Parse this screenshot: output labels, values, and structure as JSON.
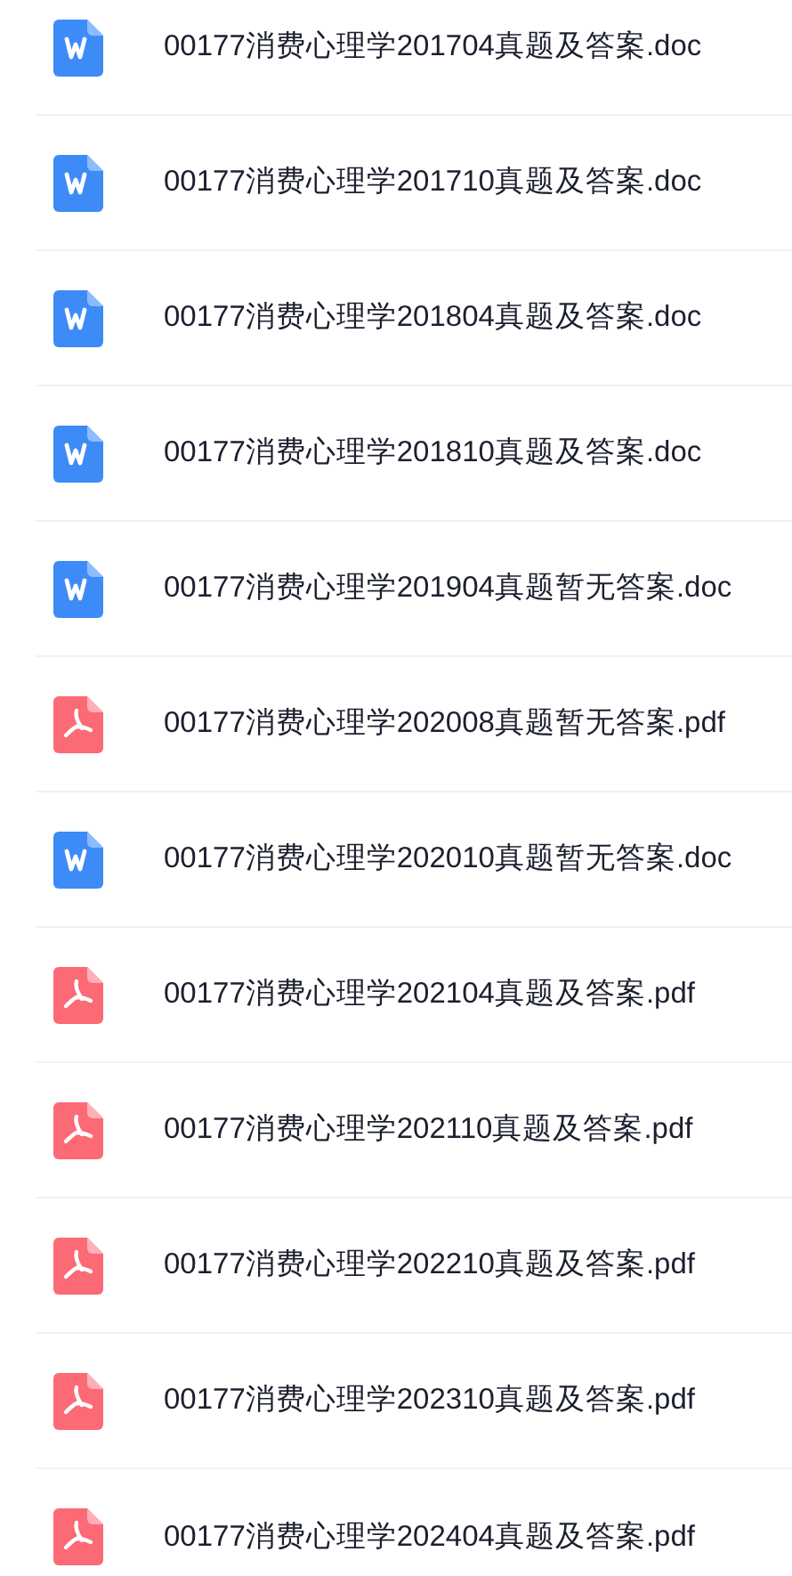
{
  "files": [
    {
      "kind": "doc",
      "name": "00177消费心理学201704真题及答案.doc"
    },
    {
      "kind": "doc",
      "name": "00177消费心理学201710真题及答案.doc"
    },
    {
      "kind": "doc",
      "name": "00177消费心理学201804真题及答案.doc"
    },
    {
      "kind": "doc",
      "name": "00177消费心理学201810真题及答案.doc"
    },
    {
      "kind": "doc",
      "name": "00177消费心理学201904真题暂无答案.doc"
    },
    {
      "kind": "pdf",
      "name": "00177消费心理学202008真题暂无答案.pdf"
    },
    {
      "kind": "doc",
      "name": "00177消费心理学202010真题暂无答案.doc"
    },
    {
      "kind": "pdf",
      "name": "00177消费心理学202104真题及答案.pdf"
    },
    {
      "kind": "pdf",
      "name": "00177消费心理学202110真题及答案.pdf"
    },
    {
      "kind": "pdf",
      "name": "00177消费心理学202210真题及答案.pdf"
    },
    {
      "kind": "pdf",
      "name": "00177消费心理学202310真题及答案.pdf"
    },
    {
      "kind": "pdf",
      "name": "00177消费心理学202404真题及答案.pdf"
    }
  ]
}
